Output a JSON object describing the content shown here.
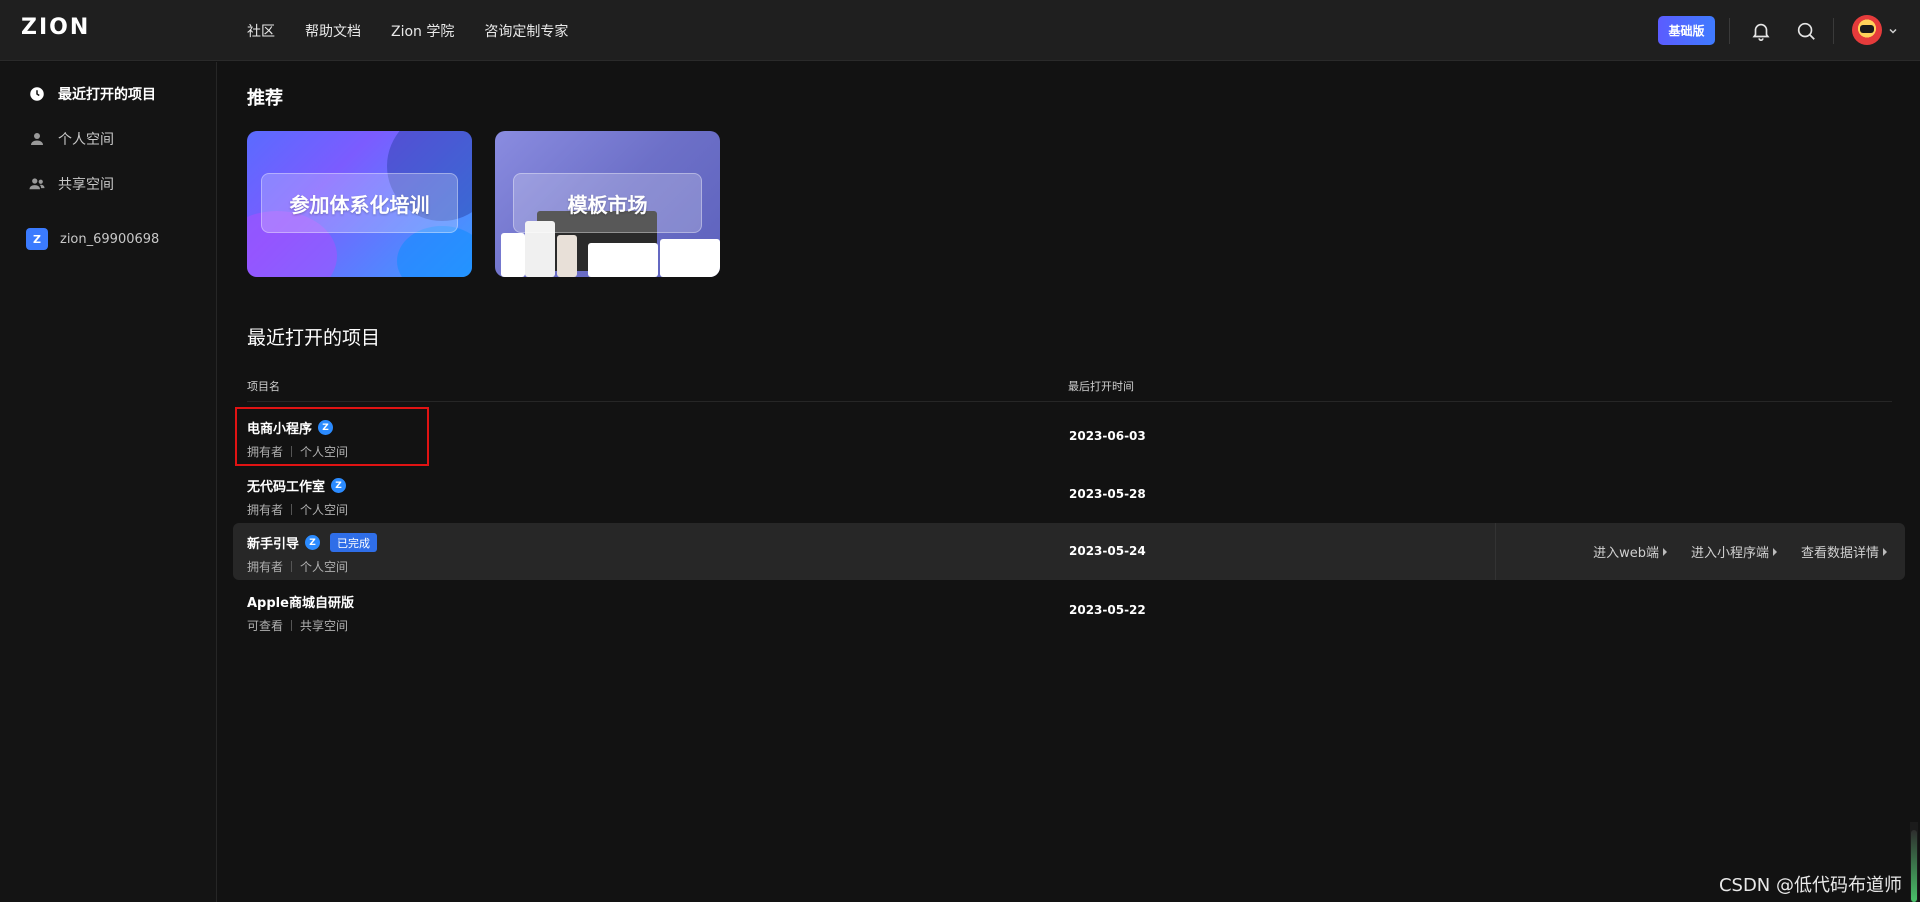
{
  "header": {
    "logo": "ZION",
    "nav": [
      "社区",
      "帮助文档",
      "Zion 学院",
      "咨询定制专家"
    ],
    "plan_badge": "基础版"
  },
  "sidebar": {
    "items": [
      {
        "label": "最近打开的项目",
        "icon": "clock-icon",
        "active": true
      },
      {
        "label": "个人空间",
        "icon": "user-icon",
        "active": false
      },
      {
        "label": "共享空间",
        "icon": "users-icon",
        "active": false
      }
    ],
    "workspace": {
      "badge": "Z",
      "name": "zion_69900698"
    }
  },
  "recommend": {
    "title": "推荐",
    "cards": [
      {
        "label": "参加体系化培训"
      },
      {
        "label": "模板市场"
      }
    ]
  },
  "recent": {
    "title": "最近打开的项目",
    "columns": {
      "name": "项目名",
      "opened": "最后打开时间"
    },
    "rows": [
      {
        "title": "电商小程序",
        "z_badge": "Z",
        "role": "拥有者",
        "space": "个人空间",
        "date": "2023-06-03",
        "status": null
      },
      {
        "title": "无代码工作室",
        "z_badge": "Z",
        "role": "拥有者",
        "space": "个人空间",
        "date": "2023-05-28",
        "status": null
      },
      {
        "title": "新手引导",
        "z_badge": "Z",
        "role": "拥有者",
        "space": "个人空间",
        "date": "2023-05-24",
        "status": "已完成"
      },
      {
        "title": "Apple商城自研版",
        "z_badge": null,
        "role": "可查看",
        "space": "共享空间",
        "date": "2023-05-22",
        "status": null
      }
    ],
    "row_actions": [
      "进入web端",
      "进入小程序端",
      "查看数据详情"
    ]
  },
  "watermark": "CSDN @低代码布道师",
  "colors": {
    "accent": "#3b7bff",
    "highlight": "#e01313",
    "background": "#121212"
  }
}
